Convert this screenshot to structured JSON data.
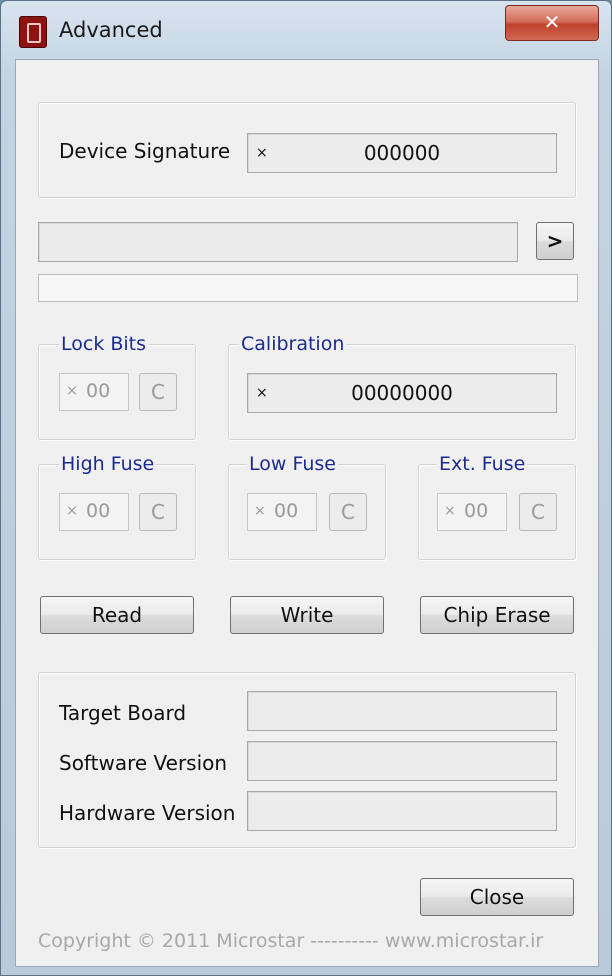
{
  "window": {
    "title": "Advanced",
    "close_glyph": "✕",
    "app_icon": "chip-icon",
    "close_color": "#c0432b"
  },
  "device_signature": {
    "label": "Device Signature",
    "prefix": "×",
    "value": "000000"
  },
  "next_button": {
    "label": ">"
  },
  "lock_bits": {
    "title": "Lock Bits",
    "prefix": "×",
    "value": "00",
    "clear_label": "C"
  },
  "calibration": {
    "title": "Calibration",
    "prefix": "×",
    "value": "00000000"
  },
  "high_fuse": {
    "title": "High Fuse",
    "prefix": "×",
    "value": "00",
    "clear_label": "C"
  },
  "low_fuse": {
    "title": "Low Fuse",
    "prefix": "×",
    "value": "00",
    "clear_label": "C"
  },
  "ext_fuse": {
    "title": "Ext. Fuse",
    "prefix": "×",
    "value": "00",
    "clear_label": "C"
  },
  "actions": {
    "read": "Read",
    "write": "Write",
    "chip_erase": "Chip Erase"
  },
  "info": {
    "target_board_label": "Target Board",
    "target_board_value": "",
    "software_version_label": "Software Version",
    "software_version_value": "",
    "hardware_version_label": "Hardware Version",
    "hardware_version_value": ""
  },
  "close_button": {
    "label": "Close"
  },
  "footer": {
    "text": "Copyright © 2011 Microstar   ----------   www.microstar.ir"
  },
  "colors": {
    "group_title": "#1b2b8f",
    "client_bg": "#f0f0f0"
  }
}
